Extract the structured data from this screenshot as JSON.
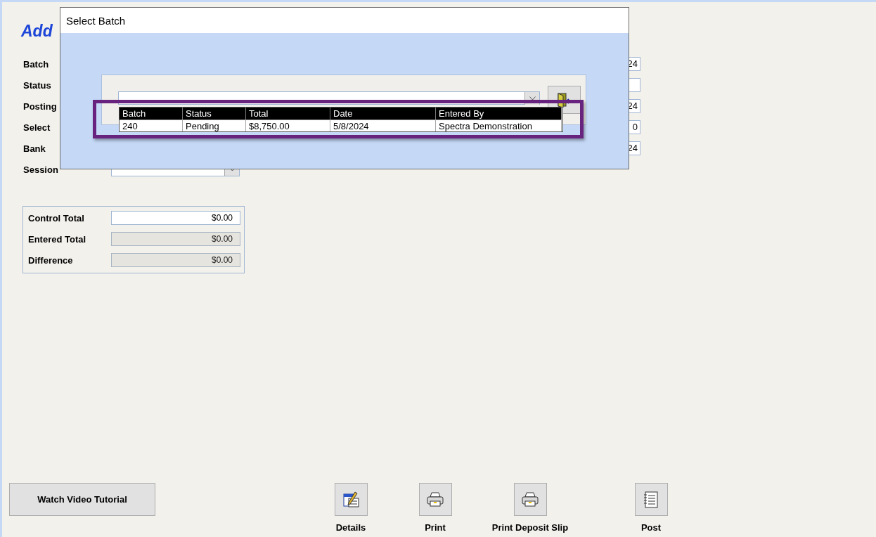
{
  "title": "Add",
  "fields": [
    {
      "label": "Batch",
      "value": "24"
    },
    {
      "label": "Status"
    },
    {
      "label": "Posting",
      "value": "24"
    },
    {
      "label": "Select",
      "value": "0"
    },
    {
      "label": "Bank",
      "value": "24"
    }
  ],
  "session_type": {
    "label": "Session"
  },
  "totals": [
    {
      "label": "Control Total",
      "value": "$0.00",
      "disabled": false
    },
    {
      "label": "Entered Total",
      "value": "$0.00",
      "disabled": true
    },
    {
      "label": "Difference",
      "value": "$0.00",
      "disabled": true
    }
  ],
  "dialog": {
    "title": "Select Batch",
    "columns": [
      "Batch",
      "Status",
      "Total",
      "Date",
      "Entered By"
    ],
    "rows": [
      [
        "240",
        "Pending",
        "$8,750.00",
        "5/8/2024",
        "Spectra Demonstration"
      ]
    ]
  },
  "buttons": [
    {
      "label": "Watch Video Tutorial",
      "kind": "text"
    },
    {
      "label": "Details",
      "kind": "edit"
    },
    {
      "label": "Print",
      "kind": "print"
    },
    {
      "label": "Print Deposit Slip",
      "kind": "print"
    },
    {
      "label": "Post",
      "kind": "list"
    }
  ]
}
